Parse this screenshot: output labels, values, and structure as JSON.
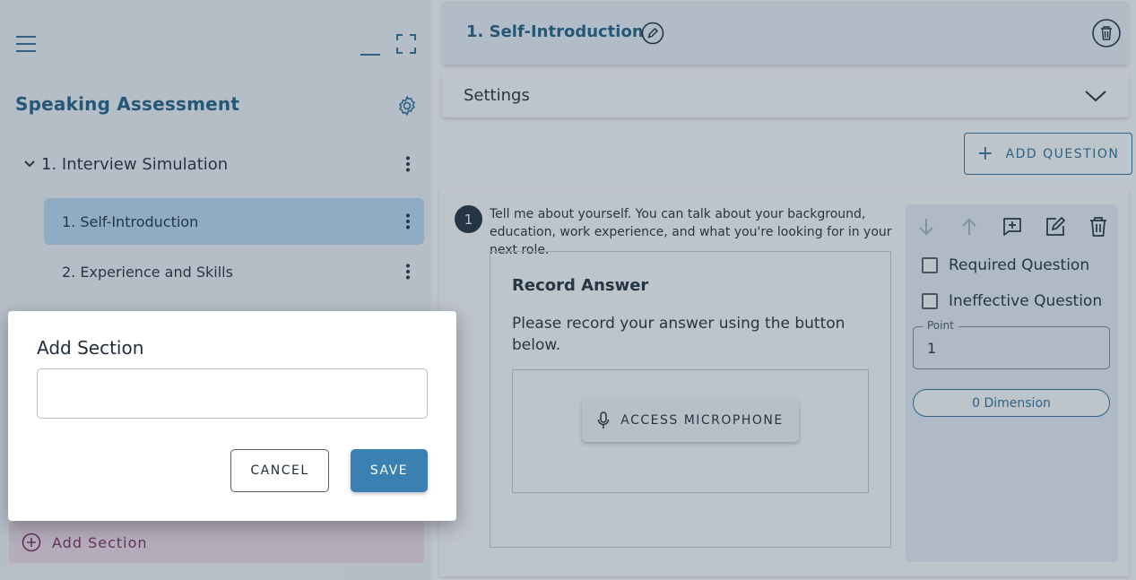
{
  "sidebar": {
    "title": "Speaking Assessment",
    "section": {
      "label": "1. Interview Simulation"
    },
    "items": [
      {
        "number": "1.",
        "label": "Self-Introduction",
        "active": true
      },
      {
        "number": "2.",
        "label": "Experience and Skills",
        "active": false
      }
    ],
    "add_section_label": "Add Section"
  },
  "main": {
    "header_title": "1. Self-Introduction",
    "settings_label": "Settings",
    "add_question_label": "ADD QUESTION",
    "question": {
      "number": "1",
      "text": "Tell me about yourself. You can talk about your background, education, work experience, and what you're looking for in your next role.",
      "answer_heading": "Record Answer",
      "answer_desc": "Please record your answer using the button below.",
      "mic_button_label": "ACCESS MICROPHONE"
    },
    "panel": {
      "required_label": "Required Question",
      "ineffective_label": "Ineffective Question",
      "point_label": "Point",
      "point_value": "1",
      "dimension_label": "0 Dimension"
    }
  },
  "dialog": {
    "title": "Add Section",
    "input_value": "",
    "cancel_label": "CANCEL",
    "save_label": "SAVE"
  },
  "colors": {
    "primary": "#3a80b1",
    "title_blue": "#1f5f85",
    "active_item": "#bcdcf4",
    "add_section_bg": "#f2dce9"
  }
}
